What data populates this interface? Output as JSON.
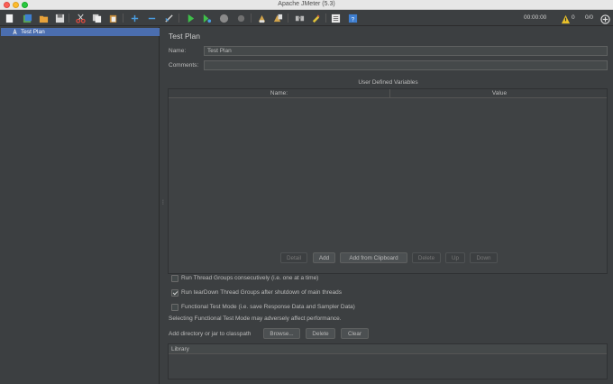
{
  "window": {
    "title": "Apache JMeter (5.3)"
  },
  "toolbar": {
    "icons": [
      "new-icon",
      "templates-icon",
      "open-icon",
      "save-icon",
      "cut-icon",
      "copy-icon",
      "paste-icon",
      "expand-icon",
      "collapse-icon",
      "toggle-icon",
      "start-icon",
      "start-no-pauses-icon",
      "stop-icon",
      "shutdown-icon",
      "clear-icon",
      "clear-all-icon",
      "search-icon",
      "reset-search-icon",
      "function-helper-icon",
      "help-icon"
    ],
    "timer": "00:00:00",
    "warnings": "0",
    "threads": "0/0"
  },
  "tree": {
    "items": [
      {
        "label": "Test Plan",
        "selected": true
      }
    ]
  },
  "main": {
    "title": "Test Plan",
    "name_label": "Name:",
    "name_value": "Test Plan",
    "comments_label": "Comments:",
    "comments_value": "",
    "udv_title": "User Defined Variables",
    "columns": [
      "Name:",
      "Value"
    ],
    "buttons": {
      "detail": "Detail",
      "add": "Add",
      "add_clipboard": "Add from Clipboard",
      "delete": "Delete",
      "up": "Up",
      "down": "Down"
    },
    "options": [
      {
        "label": "Run Thread Groups consecutively (i.e. one at a time)",
        "checked": false
      },
      {
        "label": "Run tearDown Thread Groups after shutdown of main threads",
        "checked": true
      },
      {
        "label": "Functional Test Mode (i.e. save Response Data and Sampler Data)",
        "checked": false
      }
    ],
    "functional_note": "Selecting Functional Test Mode may adversely affect performance.",
    "classpath_label": "Add directory or jar to classpath",
    "classpath_buttons": {
      "browse": "Browse...",
      "delete": "Delete",
      "clear": "Clear"
    },
    "library_label": "Library"
  }
}
